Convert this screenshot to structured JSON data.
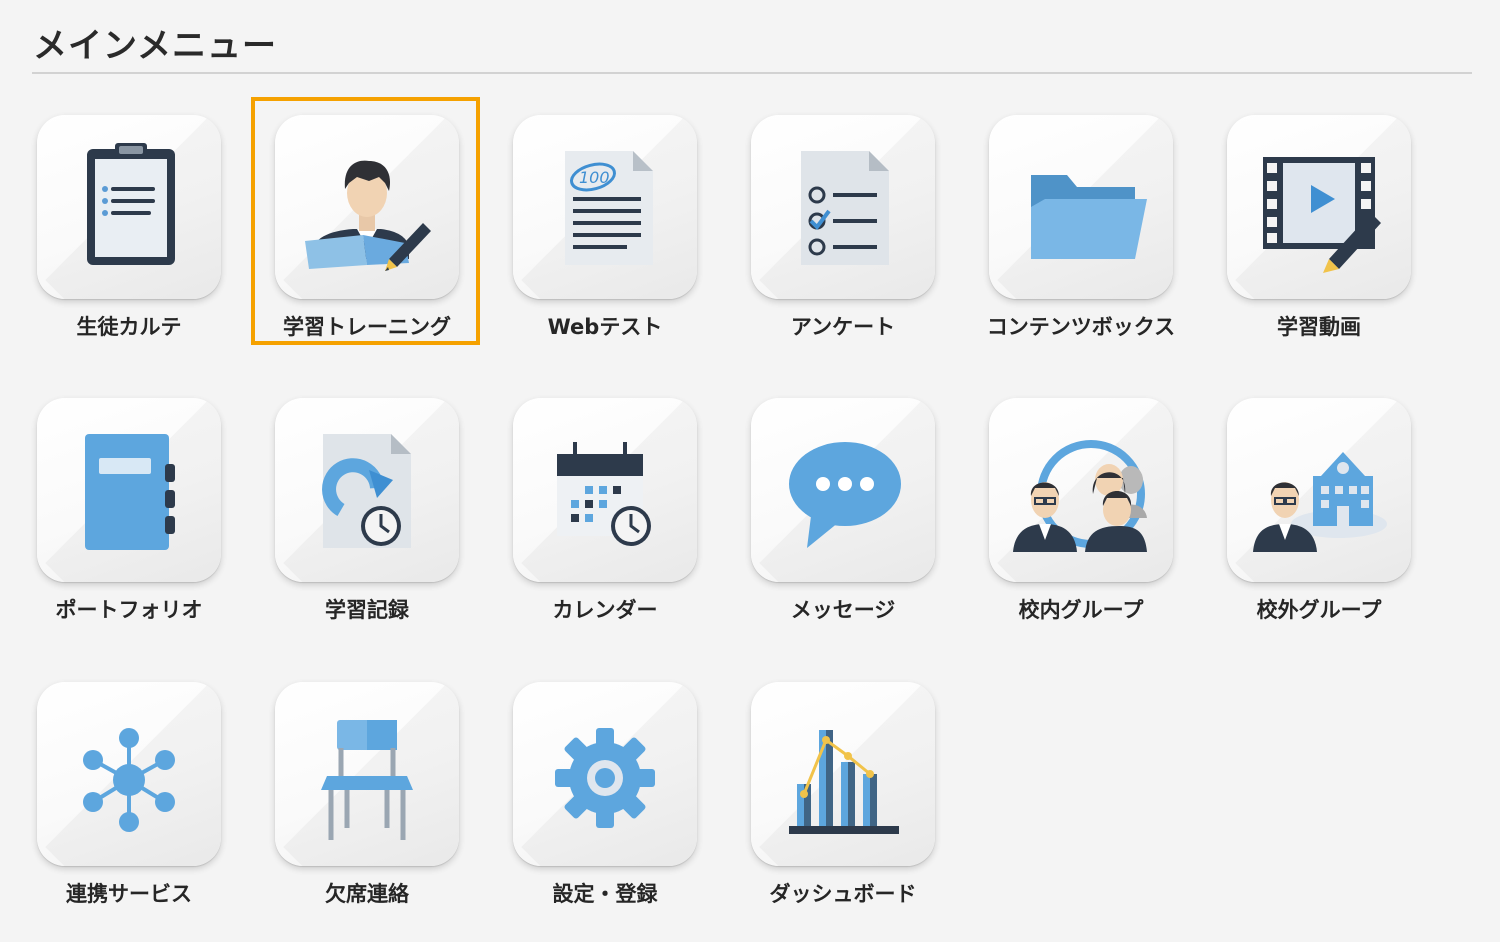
{
  "page": {
    "title": "メインメニュー"
  },
  "menu": {
    "selected_index": 1,
    "accent_color": "#f5a100",
    "items": [
      {
        "label": "生徒カルテ",
        "icon": "clipboard-icon"
      },
      {
        "label": "学習トレーニング",
        "icon": "student-study-icon"
      },
      {
        "label": "Webテスト",
        "icon": "web-test-icon"
      },
      {
        "label": "アンケート",
        "icon": "survey-checklist-icon"
      },
      {
        "label": "コンテンツボックス",
        "icon": "folder-icon"
      },
      {
        "label": "学習動画",
        "icon": "video-edit-icon"
      },
      {
        "label": "ポートフォリオ",
        "icon": "notebook-icon"
      },
      {
        "label": "学習記録",
        "icon": "study-record-icon"
      },
      {
        "label": "カレンダー",
        "icon": "calendar-icon"
      },
      {
        "label": "メッセージ",
        "icon": "speech-bubble-icon"
      },
      {
        "label": "校内グループ",
        "icon": "internal-group-icon"
      },
      {
        "label": "校外グループ",
        "icon": "external-group-icon"
      },
      {
        "label": "連携サービス",
        "icon": "network-icon"
      },
      {
        "label": "欠席連絡",
        "icon": "chair-icon"
      },
      {
        "label": "設定・登録",
        "icon": "gear-icon"
      },
      {
        "label": "ダッシュボード",
        "icon": "dashboard-chart-icon"
      }
    ]
  }
}
